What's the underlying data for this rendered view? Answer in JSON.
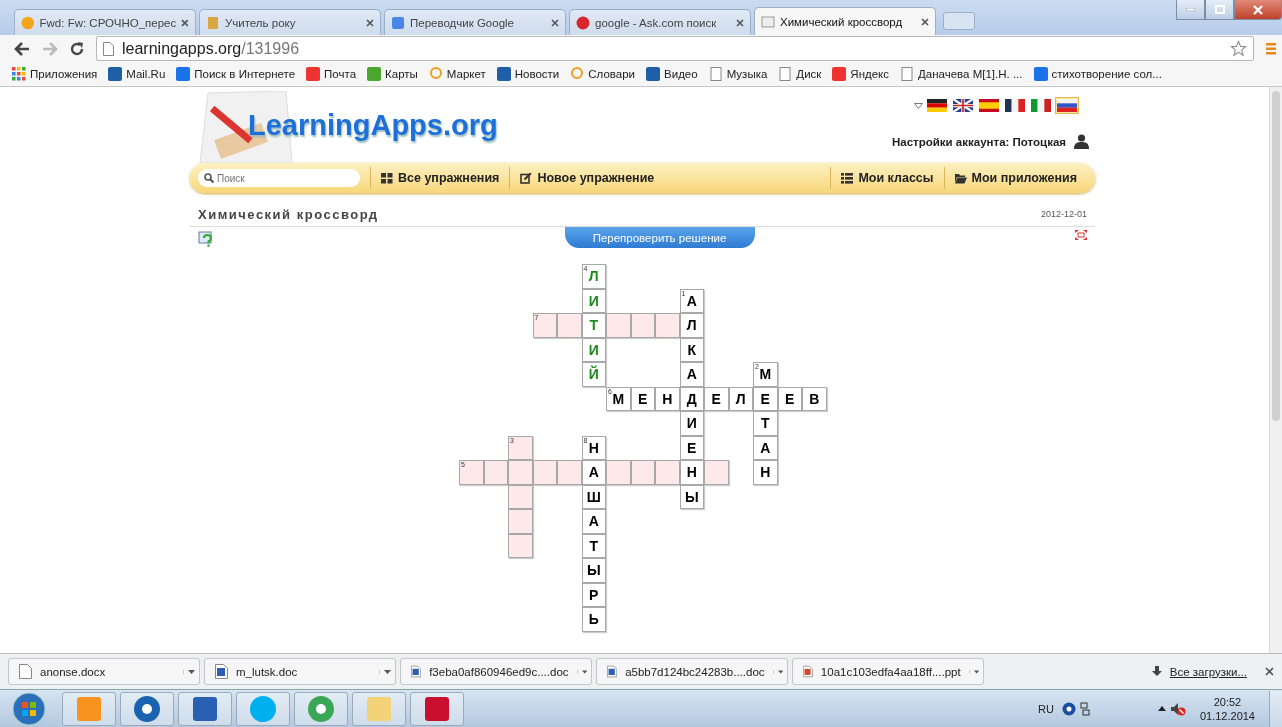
{
  "browser": {
    "tabs": [
      {
        "title": "Fwd: Fw: СРОЧНО_перес",
        "kind": "mail",
        "selected": false
      },
      {
        "title": "Учитель року",
        "kind": "book",
        "selected": false
      },
      {
        "title": "Переводчик Google",
        "kind": "translate",
        "selected": false
      },
      {
        "title": "google - Ask.com поиск",
        "kind": "ask",
        "selected": false
      },
      {
        "title": "Химический кроссворд",
        "kind": "page",
        "selected": true
      }
    ],
    "address": {
      "host": "learningapps.org",
      "path": "/131996"
    },
    "bookmarks": [
      {
        "label": "Приложения",
        "kind": "apps"
      },
      {
        "label": "Mail.Ru",
        "kind": "mail"
      },
      {
        "label": "Поиск в Интернете",
        "kind": "search"
      },
      {
        "label": "Почта",
        "kind": "yandex"
      },
      {
        "label": "Карты",
        "kind": "maps"
      },
      {
        "label": "Маркет",
        "kind": "market"
      },
      {
        "label": "Новости",
        "kind": "mail"
      },
      {
        "label": "Словари",
        "kind": "market"
      },
      {
        "label": "Видео",
        "kind": "mail"
      },
      {
        "label": "Музыка",
        "kind": "doc"
      },
      {
        "label": "Диск",
        "kind": "doc"
      },
      {
        "label": "Яндекс",
        "kind": "yandex"
      },
      {
        "label": "Даначева М[1].Н. ...",
        "kind": "doc"
      },
      {
        "label": "стихотворение сол...",
        "kind": "search"
      }
    ]
  },
  "site": {
    "logo": "LearningApps.org",
    "languages": [
      {
        "kind": "de",
        "selected": false
      },
      {
        "kind": "en",
        "selected": false
      },
      {
        "kind": "es",
        "selected": false
      },
      {
        "kind": "fr",
        "selected": false
      },
      {
        "kind": "it",
        "selected": false
      },
      {
        "kind": "ru",
        "selected": true
      }
    ],
    "account": "Настройки аккаунта: Потоцкая",
    "search": {
      "placeholder": "Поиск"
    },
    "nav": [
      {
        "label": "Все упражнения",
        "kind": "grid"
      },
      {
        "label": "Новое упражнение",
        "kind": "edit"
      },
      {
        "label": "Мои классы",
        "kind": "list"
      },
      {
        "label": "Мои приложения",
        "kind": "folder"
      }
    ],
    "title": "Химический кроссворд",
    "date": "2012-12-01",
    "check_button": "Перепроверить решение"
  },
  "crossword": {
    "rows": [
      {
        "cells": [
          {
            "kind": "gap"
          },
          {
            "kind": "gap"
          },
          {
            "kind": "gap"
          },
          {
            "kind": "gap"
          },
          {
            "kind": "gap"
          },
          {
            "kind": "correct",
            "number": "4",
            "letter": "Л"
          }
        ]
      },
      {
        "cells": [
          {
            "kind": "gap"
          },
          {
            "kind": "gap"
          },
          {
            "kind": "gap"
          },
          {
            "kind": "gap"
          },
          {
            "kind": "gap"
          },
          {
            "kind": "correct",
            "letter": "И"
          },
          {
            "kind": "gap"
          },
          {
            "kind": "gap"
          },
          {
            "kind": "gap"
          },
          {
            "kind": "shown",
            "number": "1",
            "letter": "А"
          }
        ]
      },
      {
        "cells": [
          {
            "kind": "gap"
          },
          {
            "kind": "gap"
          },
          {
            "kind": "gap"
          },
          {
            "kind": "empty",
            "number": "7"
          },
          {
            "kind": "empty"
          },
          {
            "kind": "correct",
            "letter": "Т"
          },
          {
            "kind": "empty"
          },
          {
            "kind": "empty"
          },
          {
            "kind": "empty"
          },
          {
            "kind": "shown",
            "letter": "Л"
          }
        ]
      },
      {
        "cells": [
          {
            "kind": "gap"
          },
          {
            "kind": "gap"
          },
          {
            "kind": "gap"
          },
          {
            "kind": "gap"
          },
          {
            "kind": "gap"
          },
          {
            "kind": "correct",
            "letter": "И"
          },
          {
            "kind": "gap"
          },
          {
            "kind": "gap"
          },
          {
            "kind": "gap"
          },
          {
            "kind": "shown",
            "letter": "К"
          }
        ]
      },
      {
        "cells": [
          {
            "kind": "gap"
          },
          {
            "kind": "gap"
          },
          {
            "kind": "gap"
          },
          {
            "kind": "gap"
          },
          {
            "kind": "gap"
          },
          {
            "kind": "correct",
            "letter": "Й"
          },
          {
            "kind": "gap"
          },
          {
            "kind": "gap"
          },
          {
            "kind": "gap"
          },
          {
            "kind": "shown",
            "letter": "А"
          },
          {
            "kind": "gap"
          },
          {
            "kind": "gap"
          },
          {
            "kind": "shown",
            "number": "2",
            "letter": "М"
          }
        ]
      },
      {
        "cells": [
          {
            "kind": "gap"
          },
          {
            "kind": "gap"
          },
          {
            "kind": "gap"
          },
          {
            "kind": "gap"
          },
          {
            "kind": "gap"
          },
          {
            "kind": "gap"
          },
          {
            "kind": "shown",
            "number": "6",
            "letter": "М"
          },
          {
            "kind": "shown",
            "letter": "Е"
          },
          {
            "kind": "shown",
            "letter": "Н"
          },
          {
            "kind": "shown",
            "letter": "Д"
          },
          {
            "kind": "shown",
            "letter": "Е"
          },
          {
            "kind": "shown",
            "letter": "Л"
          },
          {
            "kind": "shown",
            "letter": "Е"
          },
          {
            "kind": "shown",
            "letter": "Е"
          },
          {
            "kind": "shown",
            "letter": "В"
          }
        ]
      },
      {
        "cells": [
          {
            "kind": "gap"
          },
          {
            "kind": "gap"
          },
          {
            "kind": "gap"
          },
          {
            "kind": "gap"
          },
          {
            "kind": "gap"
          },
          {
            "kind": "gap"
          },
          {
            "kind": "gap"
          },
          {
            "kind": "gap"
          },
          {
            "kind": "gap"
          },
          {
            "kind": "shown",
            "letter": "И"
          },
          {
            "kind": "gap"
          },
          {
            "kind": "gap"
          },
          {
            "kind": "shown",
            "letter": "Т"
          }
        ]
      },
      {
        "cells": [
          {
            "kind": "gap"
          },
          {
            "kind": "gap"
          },
          {
            "kind": "empty",
            "number": "3"
          },
          {
            "kind": "gap"
          },
          {
            "kind": "gap"
          },
          {
            "kind": "shown",
            "number": "8",
            "letter": "Н"
          },
          {
            "kind": "gap"
          },
          {
            "kind": "gap"
          },
          {
            "kind": "gap"
          },
          {
            "kind": "shown",
            "letter": "Е"
          },
          {
            "kind": "gap"
          },
          {
            "kind": "gap"
          },
          {
            "kind": "shown",
            "letter": "А"
          }
        ]
      },
      {
        "cells": [
          {
            "kind": "empty",
            "number": "5"
          },
          {
            "kind": "empty"
          },
          {
            "kind": "empty"
          },
          {
            "kind": "empty"
          },
          {
            "kind": "empty"
          },
          {
            "kind": "shown",
            "letter": "А"
          },
          {
            "kind": "empty"
          },
          {
            "kind": "empty"
          },
          {
            "kind": "empty"
          },
          {
            "kind": "shown",
            "letter": "Н"
          },
          {
            "kind": "empty"
          },
          {
            "kind": "gap"
          },
          {
            "kind": "shown",
            "letter": "Н"
          }
        ]
      },
      {
        "cells": [
          {
            "kind": "gap"
          },
          {
            "kind": "gap"
          },
          {
            "kind": "empty"
          },
          {
            "kind": "gap"
          },
          {
            "kind": "gap"
          },
          {
            "kind": "shown",
            "letter": "Ш"
          },
          {
            "kind": "gap"
          },
          {
            "kind": "gap"
          },
          {
            "kind": "gap"
          },
          {
            "kind": "shown",
            "letter": "Ы"
          }
        ]
      },
      {
        "cells": [
          {
            "kind": "gap"
          },
          {
            "kind": "gap"
          },
          {
            "kind": "empty"
          },
          {
            "kind": "gap"
          },
          {
            "kind": "gap"
          },
          {
            "kind": "shown",
            "letter": "А"
          }
        ]
      },
      {
        "cells": [
          {
            "kind": "gap"
          },
          {
            "kind": "gap"
          },
          {
            "kind": "empty"
          },
          {
            "kind": "gap"
          },
          {
            "kind": "gap"
          },
          {
            "kind": "shown",
            "letter": "Т"
          }
        ]
      },
      {
        "cells": [
          {
            "kind": "gap"
          },
          {
            "kind": "gap"
          },
          {
            "kind": "gap"
          },
          {
            "kind": "gap"
          },
          {
            "kind": "gap"
          },
          {
            "kind": "shown",
            "letter": "Ы"
          }
        ]
      },
      {
        "cells": [
          {
            "kind": "gap"
          },
          {
            "kind": "gap"
          },
          {
            "kind": "gap"
          },
          {
            "kind": "gap"
          },
          {
            "kind": "gap"
          },
          {
            "kind": "shown",
            "letter": "Р"
          }
        ]
      },
      {
        "cells": [
          {
            "kind": "gap"
          },
          {
            "kind": "gap"
          },
          {
            "kind": "gap"
          },
          {
            "kind": "gap"
          },
          {
            "kind": "gap"
          },
          {
            "kind": "shown",
            "letter": "Ь"
          }
        ]
      }
    ]
  },
  "downloads": {
    "items": [
      {
        "name": "anonse.docx",
        "kind": "doc"
      },
      {
        "name": "m_lutsk.doc",
        "kind": "word"
      },
      {
        "name": "f3eba0af860946ed9c....doc",
        "kind": "word"
      },
      {
        "name": "a5bb7d124bc24283b....doc",
        "kind": "word"
      },
      {
        "name": "10a1c103edfa4aa18ff....ppt",
        "kind": "ppt"
      }
    ],
    "all_link": "Все загрузки..."
  },
  "taskbar": {
    "apps": [
      {
        "kind": "ok"
      },
      {
        "kind": "mail"
      },
      {
        "kind": "word"
      },
      {
        "kind": "skype"
      },
      {
        "kind": "chrome"
      },
      {
        "kind": "folder"
      },
      {
        "kind": "pdf"
      }
    ],
    "language": "RU",
    "time": "20:52",
    "date": "01.12.2014"
  }
}
